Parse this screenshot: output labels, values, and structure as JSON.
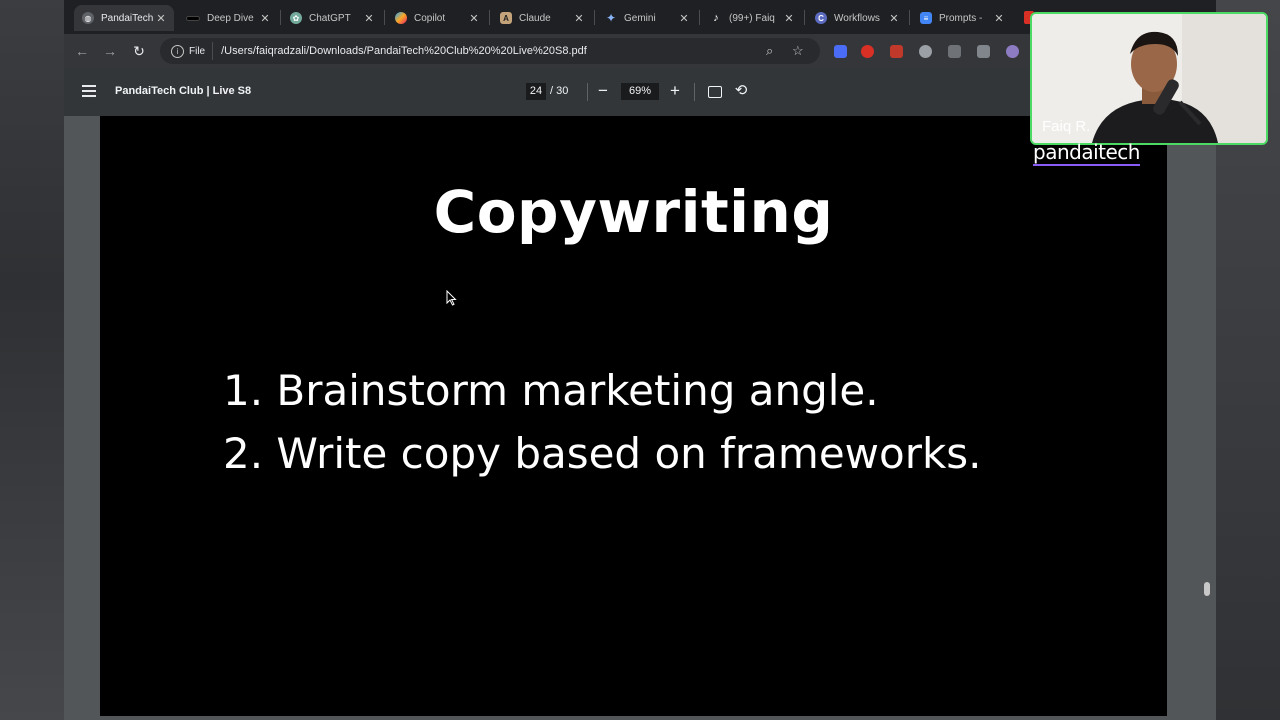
{
  "tabs": [
    {
      "title": "PandaiTech",
      "icon": "globe-icon",
      "active": true
    },
    {
      "title": "Deep Dive",
      "icon": "deep-dive-icon"
    },
    {
      "title": "ChatGPT",
      "icon": "chatgpt-icon"
    },
    {
      "title": "Copilot",
      "icon": "copilot-icon"
    },
    {
      "title": "Claude",
      "icon": "claude-icon"
    },
    {
      "title": "Gemini",
      "icon": "gemini-icon"
    },
    {
      "title": "(99+) Faiq",
      "icon": "tiktok-icon"
    },
    {
      "title": "Workflows",
      "icon": "workflows-icon"
    },
    {
      "title": "Prompts -",
      "icon": "docs-icon"
    }
  ],
  "address_bar": {
    "scheme_label": "File",
    "url": "/Users/faiqradzali/Downloads/PandaiTech%20Club%20%20Live%20S8.pdf"
  },
  "pdf_toolbar": {
    "title": "PandaiTech Club | Live S8",
    "current_page": "24",
    "total_pages": "/ 30",
    "zoom": "69%"
  },
  "slide": {
    "title": "Copywriting",
    "lines": [
      "1. Brainstorm marketing angle.",
      "2. Write copy based on frameworks."
    ]
  },
  "webcam": {
    "name": "Faiq R.",
    "brand": "pandaitech"
  },
  "colors": {
    "tab_strip": "#1f2023",
    "toolbar": "#35363a",
    "pdf_toolbar": "#323639",
    "viewer_bg": "#525659",
    "slide_bg": "#000000",
    "webcam_border": "#4cd964",
    "brand_underline": "#8a5cf6"
  }
}
